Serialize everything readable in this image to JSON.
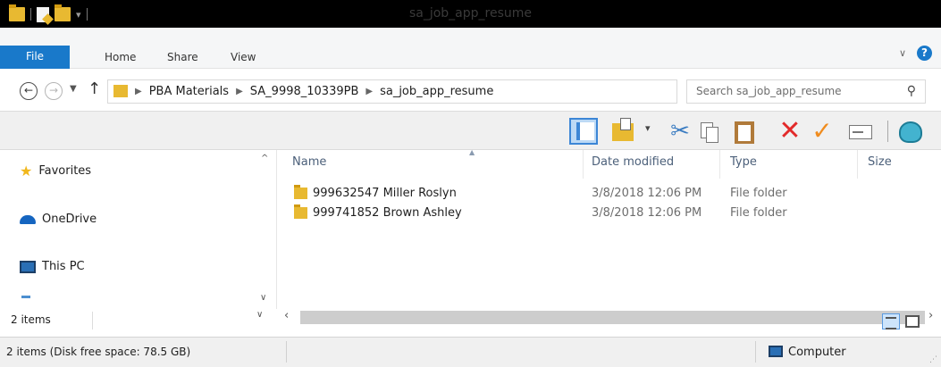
{
  "window": {
    "title": "sa_job_app_resume"
  },
  "ribbon": {
    "tabs": [
      {
        "label": "File"
      },
      {
        "label": "Home"
      },
      {
        "label": "Share"
      },
      {
        "label": "View"
      }
    ],
    "help_glyph": "?"
  },
  "address": {
    "breadcrumbs": [
      "PBA Materials",
      "SA_9998_10339PB",
      "sa_job_app_resume"
    ],
    "search_placeholder": "Search sa_job_app_resume"
  },
  "navigation": {
    "items": [
      {
        "label": "Favorites",
        "icon": "star-icon"
      },
      {
        "label": "OneDrive",
        "icon": "cloud-icon"
      },
      {
        "label": "This PC",
        "icon": "computer-icon"
      }
    ]
  },
  "files": {
    "columns": [
      "Name",
      "Date modified",
      "Type",
      "Size"
    ],
    "rows": [
      {
        "name": "999632547 Miller Roslyn",
        "date": "3/8/2018 12:06 PM",
        "type": "File folder",
        "size": ""
      },
      {
        "name": "999741852 Brown Ashley",
        "date": "3/8/2018 12:06 PM",
        "type": "File folder",
        "size": ""
      }
    ]
  },
  "status": {
    "items_count": "2 items",
    "detail": "2 items (Disk free space: 78.5 GB)",
    "location": "Computer"
  },
  "colors": {
    "accent": "#1979ca",
    "folder": "#e8b931",
    "delete": "#e22a2a",
    "check": "#f08c1e"
  }
}
